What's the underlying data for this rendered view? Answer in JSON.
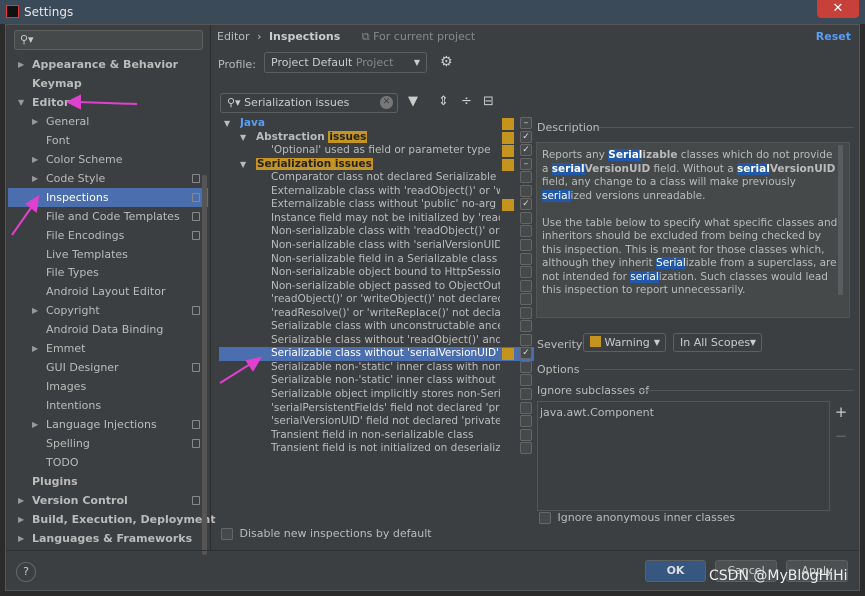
{
  "window": {
    "title": "Settings",
    "close": "✕",
    "logo": "IJ"
  },
  "sidebar": {
    "search_placeholder": "",
    "items": [
      {
        "label": "Appearance & Behavior",
        "bold": true,
        "arrow": "▶",
        "indent": 0
      },
      {
        "label": "Keymap",
        "bold": true,
        "arrow": "",
        "indent": 0
      },
      {
        "label": "Editor",
        "bold": true,
        "arrow": "▼",
        "indent": 0
      },
      {
        "label": "General",
        "arrow": "▶",
        "indent": 1
      },
      {
        "label": "Font",
        "arrow": "",
        "indent": 1
      },
      {
        "label": "Color Scheme",
        "arrow": "▶",
        "indent": 1
      },
      {
        "label": "Code Style",
        "arrow": "▶",
        "indent": 1,
        "copy": true
      },
      {
        "label": "Inspections",
        "arrow": "",
        "indent": 1,
        "copy": true,
        "selected": true
      },
      {
        "label": "File and Code Templates",
        "arrow": "",
        "indent": 1,
        "copy": true
      },
      {
        "label": "File Encodings",
        "arrow": "",
        "indent": 1,
        "copy": true
      },
      {
        "label": "Live Templates",
        "arrow": "",
        "indent": 1
      },
      {
        "label": "File Types",
        "arrow": "",
        "indent": 1
      },
      {
        "label": "Android Layout Editor",
        "arrow": "",
        "indent": 1
      },
      {
        "label": "Copyright",
        "arrow": "▶",
        "indent": 1,
        "copy": true
      },
      {
        "label": "Android Data Binding",
        "arrow": "",
        "indent": 1
      },
      {
        "label": "Emmet",
        "arrow": "▶",
        "indent": 1
      },
      {
        "label": "GUI Designer",
        "arrow": "",
        "indent": 1,
        "copy": true
      },
      {
        "label": "Images",
        "arrow": "",
        "indent": 1
      },
      {
        "label": "Intentions",
        "arrow": "",
        "indent": 1
      },
      {
        "label": "Language Injections",
        "arrow": "▶",
        "indent": 1,
        "copy": true
      },
      {
        "label": "Spelling",
        "arrow": "",
        "indent": 1,
        "copy": true
      },
      {
        "label": "TODO",
        "arrow": "",
        "indent": 1
      },
      {
        "label": "Plugins",
        "bold": true,
        "arrow": "",
        "indent": 0
      },
      {
        "label": "Version Control",
        "bold": true,
        "arrow": "▶",
        "indent": 0,
        "copy": true
      },
      {
        "label": "Build, Execution, Deployment",
        "bold": true,
        "arrow": "▶",
        "indent": 0
      },
      {
        "label": "Languages & Frameworks",
        "bold": true,
        "arrow": "▶",
        "indent": 0
      }
    ]
  },
  "header": {
    "breadcrumb_parent": "Editor",
    "breadcrumb_sep": "›",
    "breadcrumb_current": "Inspections",
    "scope_note": "For current project",
    "reset": "Reset"
  },
  "profile": {
    "label": "Profile:",
    "value": "Project Default",
    "scope": "Project"
  },
  "filter": {
    "value": "Serialization issues"
  },
  "tree": [
    {
      "text": "Java",
      "level": 0,
      "arrow": "▼",
      "color": "#589df6",
      "bold": true,
      "sev": true,
      "cb": "–"
    },
    {
      "text": "Abstraction ",
      "hl": "issues",
      "level": 1,
      "arrow": "▼",
      "bold": true,
      "sev": true,
      "cb": "✓"
    },
    {
      "text": "'Optional' used as field or parameter type",
      "level": 2,
      "sev": true,
      "cb": "✓"
    },
    {
      "text": "",
      "hl": "Serialization issues",
      "level": 1,
      "arrow": "▼",
      "sev": true,
      "cb": "–"
    },
    {
      "text": "Comparator class not declared Serializable",
      "level": 2
    },
    {
      "text": "Externalizable class with 'readObject()' or 'writeObject()'",
      "level": 2
    },
    {
      "text": "Externalizable class without 'public' no-arg constructor",
      "level": 2,
      "sev": true,
      "cb": "✓"
    },
    {
      "text": "Instance field may not be initialized by 'readObject()'",
      "level": 2
    },
    {
      "text": "Non-serializable class with 'readObject()' or 'writeObject()'",
      "level": 2
    },
    {
      "text": "Non-serializable class with 'serialVersionUID'",
      "level": 2
    },
    {
      "text": "Non-serializable field in a Serializable class",
      "level": 2
    },
    {
      "text": "Non-serializable object bound to HttpSession",
      "level": 2
    },
    {
      "text": "Non-serializable object passed to ObjectOutputStream",
      "level": 2
    },
    {
      "text": "'readObject()' or 'writeObject()' not declared 'private'",
      "level": 2
    },
    {
      "text": "'readResolve()' or 'writeReplace()' not declared 'protected'",
      "level": 2
    },
    {
      "text": "Serializable class with unconstructable ancestor",
      "level": 2
    },
    {
      "text": "Serializable class without 'readObject()' and 'writeObject()'",
      "level": 2
    },
    {
      "text": "Serializable class without 'serialVersionUID'",
      "level": 2,
      "sev": true,
      "cb": "✓",
      "selected": true
    },
    {
      "text": "Serializable non-'static' inner class with non-Serializable outer class",
      "level": 2
    },
    {
      "text": "Serializable non-'static' inner class without 'serialVersionUID'",
      "level": 2
    },
    {
      "text": "Serializable object implicitly stores non-Serializable object",
      "level": 2
    },
    {
      "text": "'serialPersistentFields' field not declared 'private static final'",
      "level": 2
    },
    {
      "text": "'serialVersionUID' field not declared 'private static final long'",
      "level": 2
    },
    {
      "text": "Transient field in non-serializable class",
      "level": 2
    },
    {
      "text": "Transient field is not initialized on deserialization",
      "level": 2
    }
  ],
  "disable_new": "Disable new inspections by default",
  "description": {
    "label": "Description",
    "p1": [
      [
        "Reports any ",
        ""
      ],
      [
        "Serial",
        "m b"
      ],
      [
        "izable",
        "b"
      ],
      [
        " classes which do not provide a ",
        ""
      ],
      [
        "serial",
        "m b"
      ],
      [
        "VersionUID",
        "b"
      ],
      [
        " field. Without a ",
        ""
      ],
      [
        "serial",
        "m b"
      ],
      [
        "VersionUID",
        "b"
      ],
      [
        " field, any change to a class will make previously ",
        ""
      ],
      [
        "serial",
        "m"
      ],
      [
        "ized versions unreadable.",
        ""
      ]
    ],
    "p2": [
      [
        "Use the table below to specify what specific classes and inheritors should be excluded from being checked by this inspection. This is meant for those classes which, although they inherit ",
        ""
      ],
      [
        "Serial",
        "m"
      ],
      [
        "izable from a superclass, are not intended for ",
        ""
      ],
      [
        "serial",
        "m"
      ],
      [
        "ization. Such classes would lead this inspection to report unnecessarily.",
        ""
      ]
    ]
  },
  "severity": {
    "label": "Severity:",
    "value": "Warning",
    "color": "#c4941c",
    "scope": "In All Scopes"
  },
  "options": {
    "label": "Options",
    "ignore_label": "Ignore subclasses of",
    "ignore_items": [
      "java.awt.Component"
    ],
    "add": "+",
    "remove": "−",
    "anon_label": "Ignore anonymous inner classes"
  },
  "footer": {
    "help": "?",
    "ok": "OK",
    "cancel": "Cancel",
    "apply": "Apply"
  },
  "watermark": "CSDN @MyBlogHiHi"
}
